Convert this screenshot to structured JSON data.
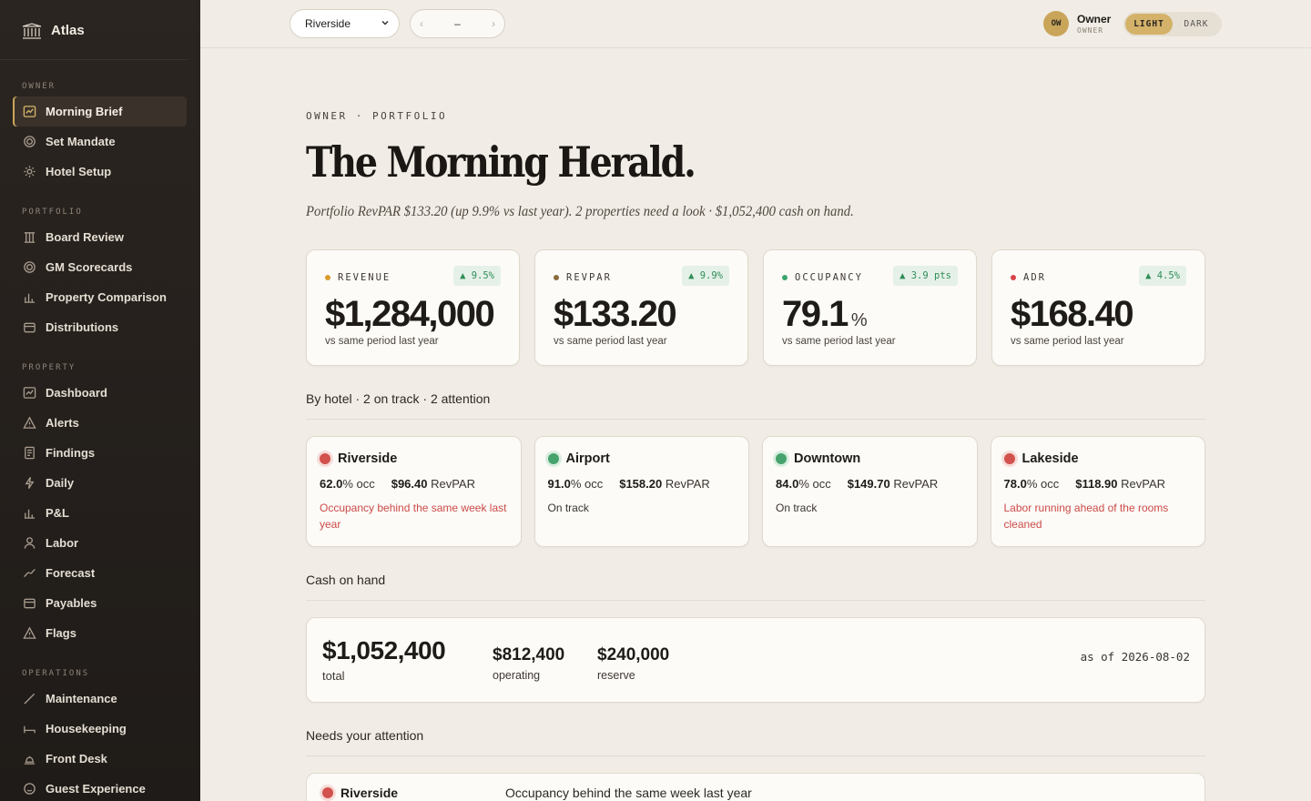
{
  "brand": {
    "name": "Atlas",
    "icon": "building-columns-icon"
  },
  "sidebar": {
    "sections": [
      {
        "label": "OWNER",
        "items": [
          {
            "label": "Morning Brief",
            "icon": "chart-line-icon",
            "active": true
          },
          {
            "label": "Set Mandate",
            "icon": "target-icon"
          },
          {
            "label": "Hotel Setup",
            "icon": "gear-icon"
          }
        ]
      },
      {
        "label": "PORTFOLIO",
        "items": [
          {
            "label": "Board Review",
            "icon": "columns-icon"
          },
          {
            "label": "GM Scorecards",
            "icon": "target-icon"
          },
          {
            "label": "Property Comparison",
            "icon": "bar-chart-icon"
          },
          {
            "label": "Distributions",
            "icon": "wallet-icon"
          }
        ]
      },
      {
        "label": "PROPERTY",
        "items": [
          {
            "label": "Dashboard",
            "icon": "chart-line-icon"
          },
          {
            "label": "Alerts",
            "icon": "warning-icon"
          },
          {
            "label": "Findings",
            "icon": "document-icon"
          },
          {
            "label": "Daily",
            "icon": "bolt-icon"
          },
          {
            "label": "P&L",
            "icon": "bar-chart-icon"
          },
          {
            "label": "Labor",
            "icon": "person-icon"
          },
          {
            "label": "Forecast",
            "icon": "trend-icon"
          },
          {
            "label": "Payables",
            "icon": "wallet-icon"
          },
          {
            "label": "Flags",
            "icon": "warning-icon"
          }
        ]
      },
      {
        "label": "OPERATIONS",
        "items": [
          {
            "label": "Maintenance",
            "icon": "wrench-icon"
          },
          {
            "label": "Housekeeping",
            "icon": "bed-icon"
          },
          {
            "label": "Front Desk",
            "icon": "bell-icon"
          },
          {
            "label": "Guest Experience",
            "icon": "smile-icon"
          }
        ]
      }
    ]
  },
  "topbar": {
    "hotel_select": "Riverside",
    "date_prev": "‹",
    "date_value": "–",
    "date_next": "›",
    "user": {
      "initials": "OW",
      "name": "Owner",
      "role": "OWNER"
    },
    "theme": {
      "light": "LIGHT",
      "dark": "DARK",
      "selected": "LIGHT"
    }
  },
  "header": {
    "eyebrow": "OWNER · PORTFOLIO",
    "title": "The Morning Herald.",
    "subtitle": "Portfolio RevPAR $133.20 (up 9.9% vs last year). 2 properties need a look · $1,052,400 cash on hand."
  },
  "kpis": [
    {
      "label": "REVENUE",
      "dot_color": "#d99a2b",
      "delta": "▲ 9.5%",
      "value": "$1,284,000",
      "unit": "",
      "sub": "vs same period last year"
    },
    {
      "label": "REVPAR",
      "dot_color": "#8a6a3a",
      "delta": "▲ 9.9%",
      "value": "$133.20",
      "unit": "",
      "sub": "vs same period last year"
    },
    {
      "label": "OCCUPANCY",
      "dot_color": "#3aa56c",
      "delta": "▲ 3.9 pts",
      "value": "79.1",
      "unit": "%",
      "sub": "vs same period last year"
    },
    {
      "label": "ADR",
      "dot_color": "#d9434a",
      "delta": "▲ 4.5%",
      "value": "$168.40",
      "unit": "",
      "sub": "vs same period last year"
    }
  ],
  "by_hotel": {
    "title": "By hotel · 2 on track · 2 attention",
    "hotels": [
      {
        "name": "Riverside",
        "status": "bad",
        "occ": "62.0",
        "occ_suffix": "% occ",
        "revpar": "$96.40",
        "revpar_suffix": "RevPAR",
        "note": "Occupancy behind the same week last year"
      },
      {
        "name": "Airport",
        "status": "ok",
        "occ": "91.0",
        "occ_suffix": "% occ",
        "revpar": "$158.20",
        "revpar_suffix": "RevPAR",
        "note": "On track"
      },
      {
        "name": "Downtown",
        "status": "ok",
        "occ": "84.0",
        "occ_suffix": "% occ",
        "revpar": "$149.70",
        "revpar_suffix": "RevPAR",
        "note": "On track"
      },
      {
        "name": "Lakeside",
        "status": "bad",
        "occ": "78.0",
        "occ_suffix": "% occ",
        "revpar": "$118.90",
        "revpar_suffix": "RevPAR",
        "note": "Labor running ahead of the rooms cleaned"
      }
    ]
  },
  "cash": {
    "title": "Cash on hand",
    "total": "$1,052,400",
    "total_label": "total",
    "operating": "$812,400",
    "operating_label": "operating",
    "reserve": "$240,000",
    "reserve_label": "reserve",
    "as_of": "as of 2026-08-02"
  },
  "attention": {
    "title": "Needs your attention",
    "items": [
      {
        "name": "Riverside",
        "text": "Occupancy behind the same week last year"
      }
    ]
  }
}
